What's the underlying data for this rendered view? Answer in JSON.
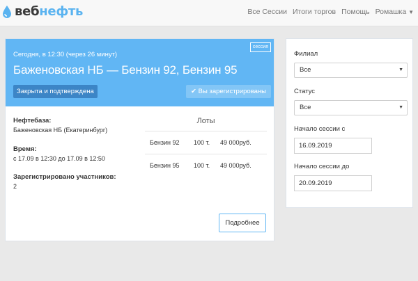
{
  "brand": {
    "logo_part1": "веб",
    "logo_part2": "нефть",
    "accent": "#5ab3f0"
  },
  "nav": {
    "items": [
      "Все Сессии",
      "Итоги торгов",
      "Помощь"
    ],
    "user_menu": "Ромашка"
  },
  "session": {
    "tag": "сессия",
    "date_line": "Сегодня, в 12:30 (через 26 минут)",
    "title": "Баженовская НБ — Бензин 92, Бензин 95",
    "status": "Закрыта и подтверждена",
    "registered_badge": "Вы зарегистрированы",
    "header_color": "#61b6f4",
    "depot_label": "Нефтебаза:",
    "depot_value": "Баженовская НБ (Екатеринбург)",
    "time_label": "Время:",
    "time_value": "с 17.09 в 12:30 до 17.09 в 12:50",
    "participants_label": "Зарегистрировано участников:",
    "participants_value": "2",
    "lots_title": "Лоты",
    "lots": [
      {
        "product": "Бензин 92",
        "qty": "100 т.",
        "price": "49 000руб."
      },
      {
        "product": "Бензин 95",
        "qty": "100 т.",
        "price": "49 000руб."
      }
    ],
    "more_button": "Подробнее"
  },
  "filters": {
    "branch_label": "Филиал",
    "branch_value": "Все",
    "status_label": "Статус",
    "status_value": "Все",
    "start_from_label": "Начало сессии с",
    "start_from_value": "16.09.2019",
    "start_to_label": "Начало сессии до",
    "start_to_value": "20.09.2019"
  }
}
